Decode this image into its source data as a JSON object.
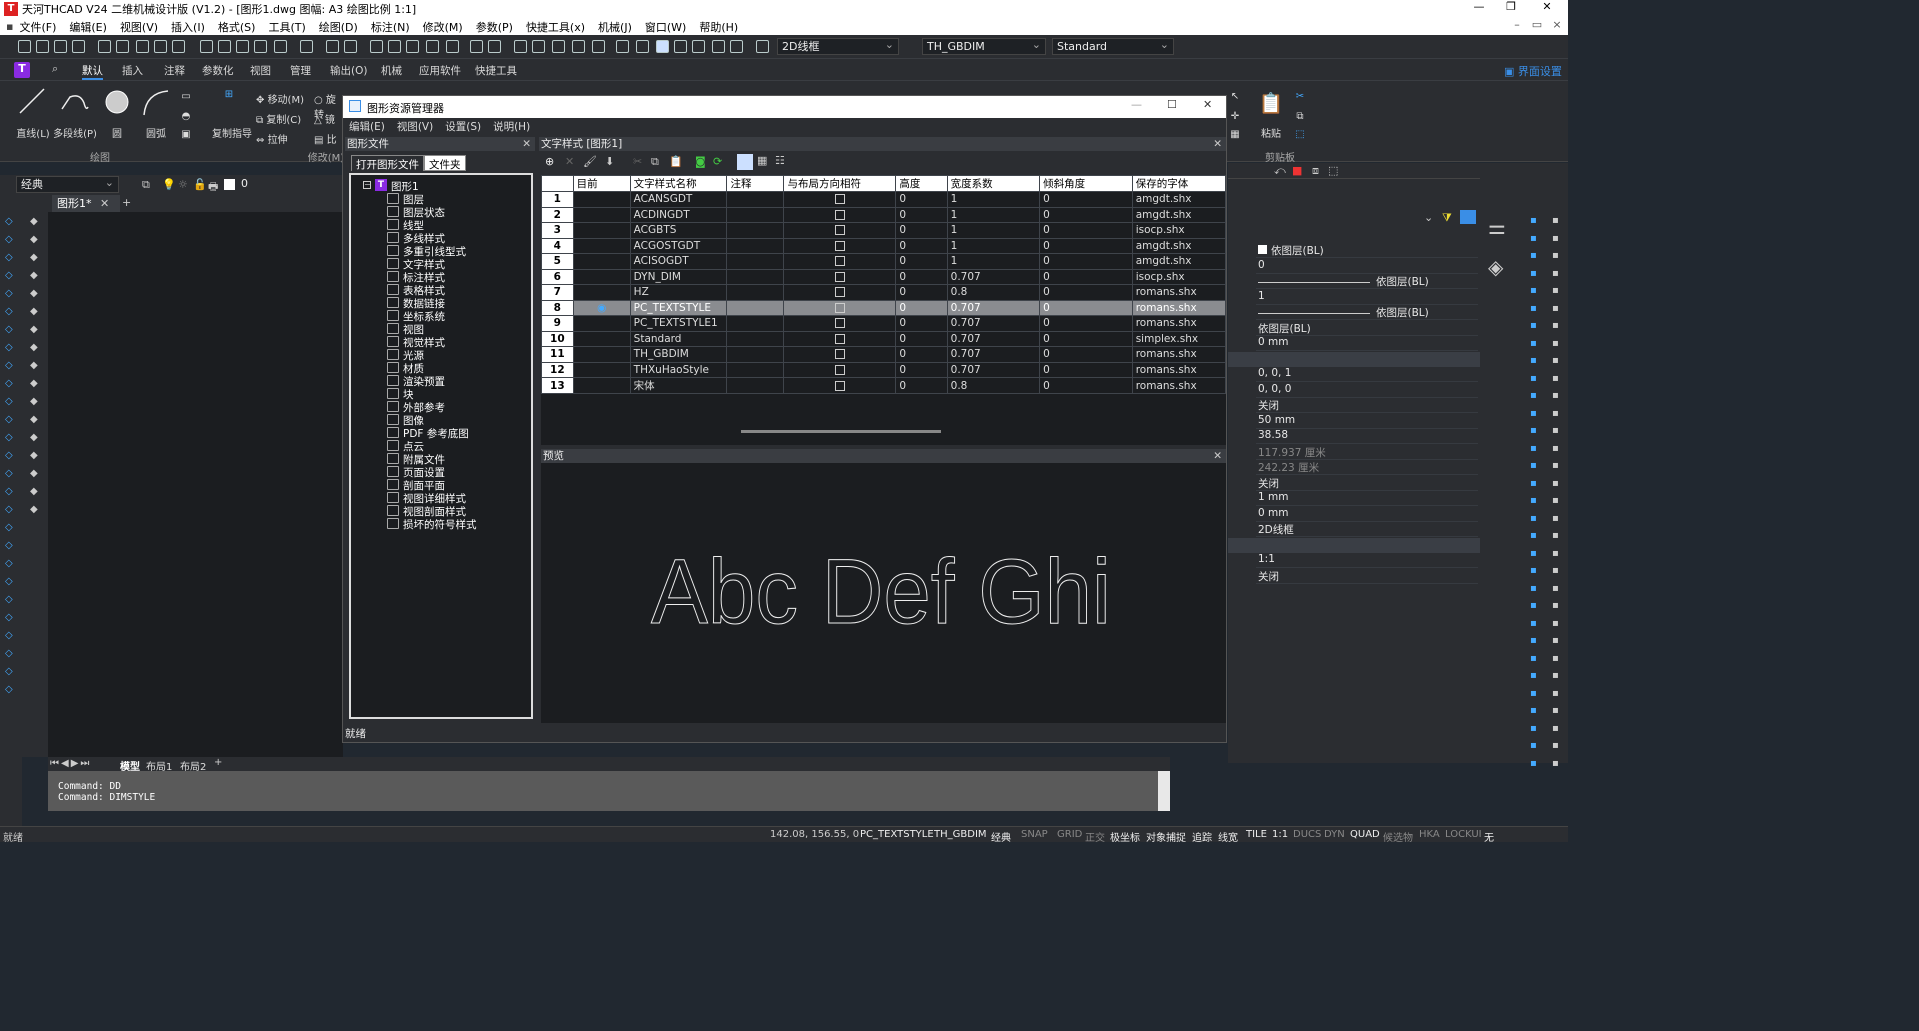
{
  "app": {
    "title": "天河THCAD V24 二维机械设计版 (V1.2) - [图形1.dwg 图幅: A3 绘图比例 1:1]",
    "icon": "thcad-logo-icon"
  },
  "menubar": {
    "items": [
      "文件(F)",
      "编辑(E)",
      "视图(V)",
      "插入(I)",
      "格式(S)",
      "工具(T)",
      "绘图(D)",
      "标注(N)",
      "修改(M)",
      "参数(P)",
      "快捷工具(x)",
      "机械(J)",
      "窗口(W)",
      "帮助(H)"
    ]
  },
  "toolbar": {
    "visual_style": "2D线框",
    "dim_style": "TH_GBDIM",
    "text_style": "Standard"
  },
  "ribbon_tabs": [
    "默认",
    "插入",
    "注释",
    "参数化",
    "视图",
    "管理",
    "输出(O)",
    "机械",
    "应用软件",
    "快捷工具"
  ],
  "ribbon_tab_active": "默认",
  "interface_settings": "界面设置",
  "ribbon": {
    "line": "直线(L)",
    "pline": "多段线(P)",
    "circle": "圆",
    "arc": "圆弧",
    "draw_group": "绘图",
    "move": "移动(M)",
    "copy": "复制(C)",
    "stretch": "拉伸",
    "copy_guide": "复制指导",
    "modify_group": "修改(M)",
    "rotate": "旋转",
    "mirror": "镜",
    "scale": "比",
    "paste": "粘贴",
    "clipboard_group": "剪贴板"
  },
  "workspace": "经典",
  "layer_value": "0",
  "doc_tab": "图形1*",
  "layout_tabs": [
    "模型",
    "布局1",
    "布局2"
  ],
  "command_lines": [
    "Command: DD",
    "Command: DIMSTYLE"
  ],
  "statusbar": {
    "left": "就绪",
    "coords": "142.08, 156.55, 0",
    "items": [
      "PC_TEXTSTYLE",
      "TH_GBDIM",
      "经典",
      "SNAP",
      "GRID",
      "正交",
      "极坐标",
      "对象捕捉",
      "追踪",
      "线宽",
      "TILE",
      "1:1",
      "DUCS",
      "DYN",
      "QUAD",
      "候选物",
      "HKA",
      "LOCKUI",
      "无"
    ]
  },
  "properties": {
    "rows": [
      {
        "v": "依图层(BL)",
        "chk": true
      },
      {
        "v": "0"
      },
      {
        "v": "依图层(BL)",
        "line": true
      },
      {
        "v": "1"
      },
      {
        "v": "依图层(BL)",
        "line": true
      },
      {
        "v": "依图层(BL)"
      },
      {
        "v": "0 mm"
      },
      {
        "v": "",
        "sect": true
      },
      {
        "v": "0, 0, 1"
      },
      {
        "v": "0, 0, 0"
      },
      {
        "v": "关闭"
      },
      {
        "v": "50 mm"
      },
      {
        "v": "38.58"
      },
      {
        "v": "117.937 厘米",
        "dim": true
      },
      {
        "v": "242.23 厘米",
        "dim": true
      },
      {
        "v": "关闭"
      },
      {
        "v": "1 mm"
      },
      {
        "v": "0 mm"
      },
      {
        "v": "2D线框"
      },
      {
        "v": "",
        "sect": true
      },
      {
        "v": "1:1"
      },
      {
        "v": "关闭"
      }
    ]
  },
  "dialog": {
    "title": "图形资源管理器",
    "menu": [
      "编辑(E)",
      "视图(V)",
      "设置(S)",
      "说明(H)"
    ],
    "left_pane_title": "图形文件",
    "left_tabs": [
      "打开图形文件",
      "文件夹"
    ],
    "tree_root": "图形1",
    "tree_items": [
      "图层",
      "图层状态",
      "线型",
      "多线样式",
      "多重引线型式",
      "文字样式",
      "标注样式",
      "表格样式",
      "数据链接",
      "坐标系统",
      "视图",
      "视觉样式",
      "光源",
      "材质",
      "渲染预置",
      "块",
      "外部参考",
      "图像",
      "PDF 参考底图",
      "点云",
      "附属文件",
      "页面设置",
      "剖面平面",
      "视图详细样式",
      "视图剖面样式",
      "损坏的符号样式"
    ],
    "right_pane_title": "文字样式 [图形1]",
    "columns": [
      "目前",
      "文字样式名称",
      "注释",
      "与布局方向相符",
      "高度",
      "宽度系数",
      "倾斜角度",
      "保存的字体"
    ],
    "rows": [
      {
        "n": "1",
        "name": "ACANSGDT",
        "h": "0",
        "w": "1",
        "a": "0",
        "font": "amgdt.shx"
      },
      {
        "n": "2",
        "name": "ACDINGDT",
        "h": "0",
        "w": "1",
        "a": "0",
        "font": "amgdt.shx"
      },
      {
        "n": "3",
        "name": "ACGBTS",
        "h": "0",
        "w": "1",
        "a": "0",
        "font": "isocp.shx"
      },
      {
        "n": "4",
        "name": "ACGOSTGDT",
        "h": "0",
        "w": "1",
        "a": "0",
        "font": "amgdt.shx"
      },
      {
        "n": "5",
        "name": "ACISOGDT",
        "h": "0",
        "w": "1",
        "a": "0",
        "font": "amgdt.shx"
      },
      {
        "n": "6",
        "name": "DYN_DIM",
        "h": "0",
        "w": "0.707",
        "a": "0",
        "font": "isocp.shx"
      },
      {
        "n": "7",
        "name": "HZ",
        "h": "0",
        "w": "0.8",
        "a": "0",
        "font": "romans.shx"
      },
      {
        "n": "8",
        "name": "PC_TEXTSTYLE",
        "h": "0",
        "w": "0.707",
        "a": "0",
        "font": "romans.shx",
        "current": true
      },
      {
        "n": "9",
        "name": "PC_TEXTSTYLE1",
        "h": "0",
        "w": "0.707",
        "a": "0",
        "font": "romans.shx"
      },
      {
        "n": "10",
        "name": "Standard",
        "h": "0",
        "w": "0.707",
        "a": "0",
        "font": "simplex.shx"
      },
      {
        "n": "11",
        "name": "TH_GBDIM",
        "h": "0",
        "w": "0.707",
        "a": "0",
        "font": "romans.shx"
      },
      {
        "n": "12",
        "name": "THXuHaoStyle",
        "h": "0",
        "w": "0.707",
        "a": "0",
        "font": "romans.shx"
      },
      {
        "n": "13",
        "name": "宋体",
        "h": "0",
        "w": "0.8",
        "a": "0",
        "font": "romans.shx"
      }
    ],
    "preview_title": "预览",
    "preview_text": "Abc Def Ghi",
    "status": "就绪"
  }
}
